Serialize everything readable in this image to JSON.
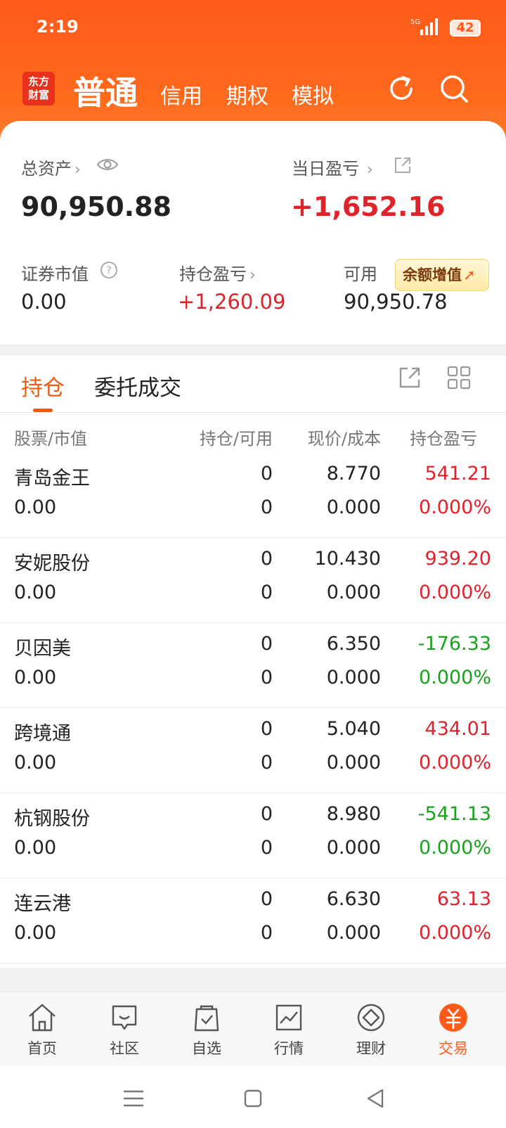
{
  "status": {
    "time": "2:19",
    "battery": "42",
    "network": "5G"
  },
  "header": {
    "logo_line1": "东方",
    "logo_line2": "财富",
    "tabs": [
      "普通",
      "信用",
      "期权",
      "模拟"
    ],
    "icons": [
      "refresh-icon",
      "search-icon"
    ]
  },
  "summary": {
    "total_assets_label": "总资产",
    "total_assets": "90,950.88",
    "daily_pl_label": "当日盈亏",
    "daily_pl": "+1,652.16",
    "market_value_label": "证券市值",
    "market_value": "0.00",
    "position_pl_label": "持仓盈亏",
    "position_pl": "+1,260.09",
    "available_label": "可用",
    "available": "90,950.78",
    "boost_label": "余额增值"
  },
  "tabs": {
    "holdings": "持仓",
    "orders": "委托成交"
  },
  "columns": {
    "stock": "股票/市值",
    "position": "持仓/可用",
    "price": "现价/成本",
    "pl": "持仓盈亏"
  },
  "holdings": [
    {
      "name": "青岛金王",
      "value": "0.00",
      "qty": "0",
      "avail": "0",
      "price": "8.770",
      "cost": "0.000",
      "pl": "541.21",
      "pct": "0.000%",
      "dir": "up"
    },
    {
      "name": "安妮股份",
      "value": "0.00",
      "qty": "0",
      "avail": "0",
      "price": "10.430",
      "cost": "0.000",
      "pl": "939.20",
      "pct": "0.000%",
      "dir": "up"
    },
    {
      "name": "贝因美",
      "value": "0.00",
      "qty": "0",
      "avail": "0",
      "price": "6.350",
      "cost": "0.000",
      "pl": "-176.33",
      "pct": "0.000%",
      "dir": "down"
    },
    {
      "name": "跨境通",
      "value": "0.00",
      "qty": "0",
      "avail": "0",
      "price": "5.040",
      "cost": "0.000",
      "pl": "434.01",
      "pct": "0.000%",
      "dir": "up"
    },
    {
      "name": "杭钢股份",
      "value": "0.00",
      "qty": "0",
      "avail": "0",
      "price": "8.980",
      "cost": "0.000",
      "pl": "-541.13",
      "pct": "0.000%",
      "dir": "down"
    },
    {
      "name": "连云港",
      "value": "0.00",
      "qty": "0",
      "avail": "0",
      "price": "6.630",
      "cost": "0.000",
      "pl": "63.13",
      "pct": "0.000%",
      "dir": "up"
    }
  ],
  "colors": {
    "accent": "#ff5a1a",
    "up": "#e0222a",
    "down": "#1aa01f"
  },
  "bottom_nav": [
    {
      "label": "首页",
      "icon": "home-icon"
    },
    {
      "label": "社区",
      "icon": "community-icon"
    },
    {
      "label": "自选",
      "icon": "watchlist-icon"
    },
    {
      "label": "行情",
      "icon": "market-icon"
    },
    {
      "label": "理财",
      "icon": "wealth-icon"
    },
    {
      "label": "交易",
      "icon": "trade-icon",
      "active": true
    }
  ]
}
